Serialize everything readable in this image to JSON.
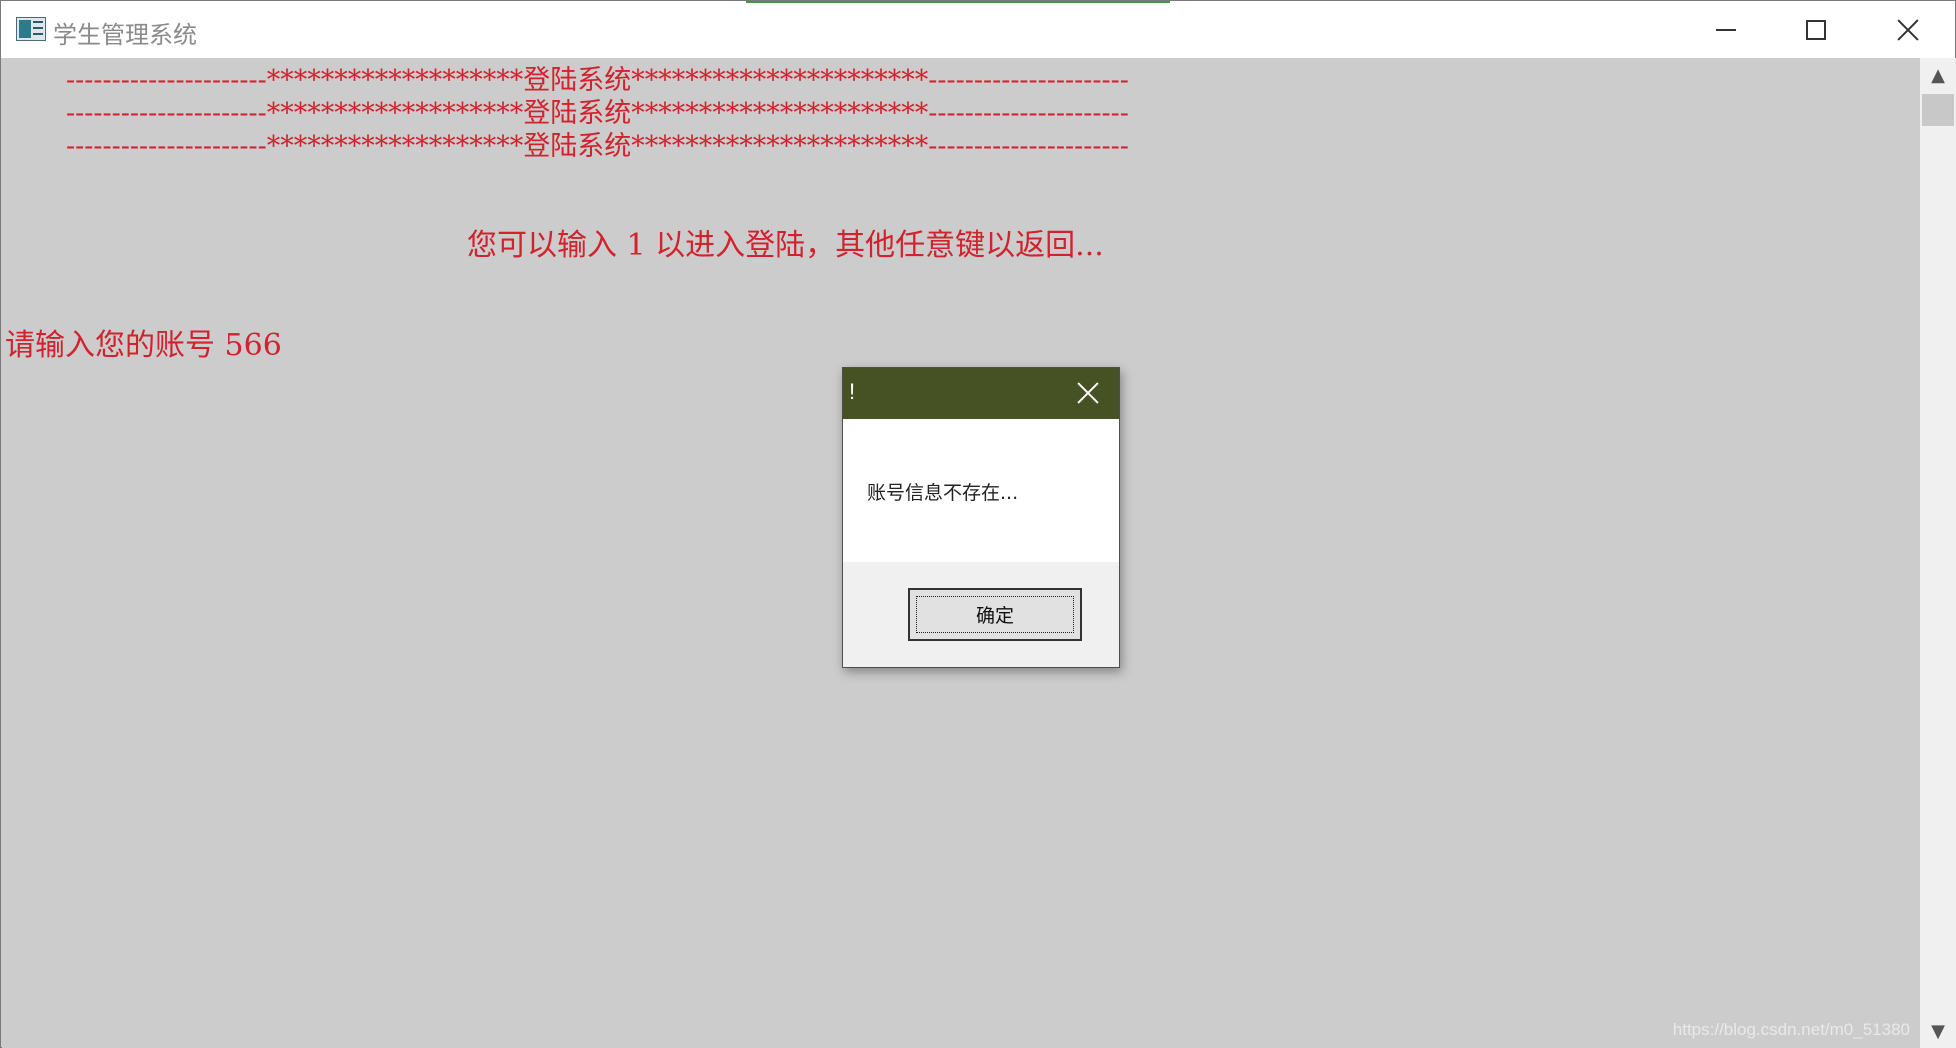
{
  "window": {
    "title": "学生管理系统",
    "icons": {
      "app": "app-window-icon",
      "minimize": "minimize-icon",
      "maximize": "maximize-icon",
      "close": "close-icon"
    }
  },
  "console": {
    "text_color": "#d2222d",
    "background": "#cccccc",
    "banner_line_1": "----------------------*******************登陆系统**********************----------------------",
    "banner_line_2": "----------------------*******************登陆系统**********************----------------------",
    "banner_line_3": "----------------------*******************登陆系统**********************----------------------",
    "prompt_enter": "您可以输入 1 以进入登陆，其他任意键以返回...",
    "prompt_account": "请输入您的账号 566"
  },
  "scrollbar": {
    "up_arrow": "▲",
    "down_arrow": "▼"
  },
  "dialog": {
    "title": "!",
    "title_bar_color": "#465223",
    "message": "账号信息不存在...",
    "ok_label": "确定"
  },
  "watermark": "https://blog.csdn.net/m0_51380"
}
